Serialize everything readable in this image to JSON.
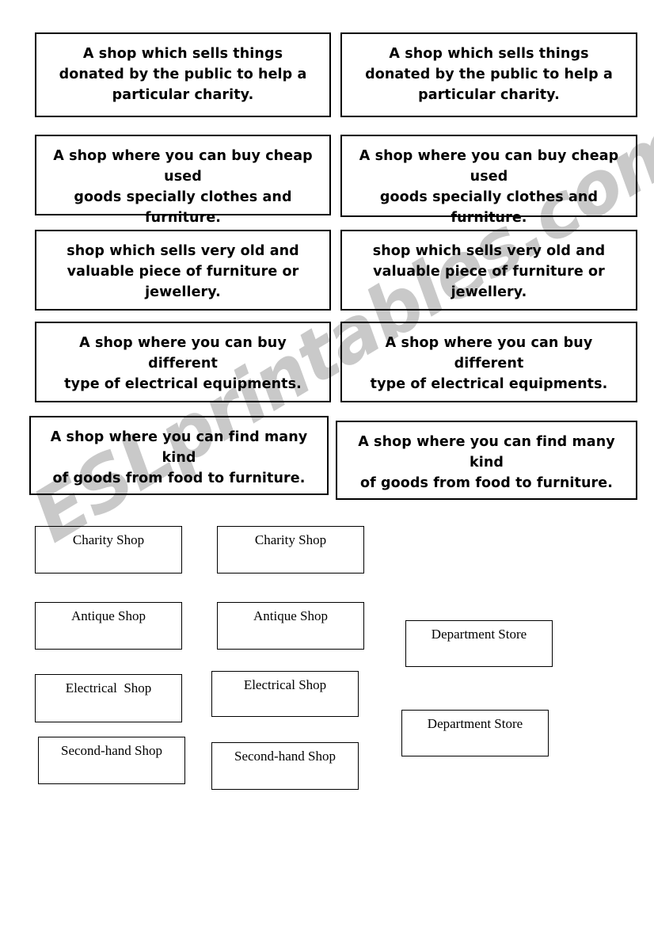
{
  "watermark": {
    "text": "ESLprintables.com",
    "color": "#c9c9c9"
  },
  "worksheet": {
    "definition_cards": [
      {
        "id": "charity-shop-definition-left",
        "text": "A shop which sells things\ndonated by the public to help a\nparticular charity.",
        "align": "center"
      },
      {
        "id": "charity-shop-definition-right",
        "text": "A shop which sells things\ndonated by the public to help a\nparticular charity.",
        "align": "center"
      },
      {
        "id": "second-hand-shop-definition-left",
        "text": "A shop where you can buy cheap used\ngoods specially clothes and furniture.",
        "align": "center"
      },
      {
        "id": "second-hand-shop-definition-right",
        "text": "A shop where you can buy cheap used\ngoods specially clothes and furniture.",
        "align": "center"
      },
      {
        "id": "antique-shop-definition-left",
        "text": "shop which sells very old and\nvaluable piece of furniture or\njewellery.",
        "align": "center"
      },
      {
        "id": "antique-shop-definition-right",
        "text": "shop which sells very old and\nvaluable piece of furniture or\njewellery.",
        "align": "center"
      },
      {
        "id": "electrical-shop-definition-left",
        "text": "A shop where you can buy different\ntype of electrical equipments.",
        "align": "center"
      },
      {
        "id": "electrical-shop-definition-right",
        "text": "A shop where you can buy different\ntype of electrical equipments.",
        "align": "center"
      },
      {
        "id": "department-store-definition-left",
        "text": "A shop where you can find many kind\nof goods from food to furniture.",
        "align": "center"
      },
      {
        "id": "department-store-definition-right",
        "text": "A shop where you can find many kind\nof goods from food to furniture.",
        "align": "center"
      }
    ],
    "label_cards": [
      {
        "id": "charity-shop-label-1",
        "text": "Charity Shop"
      },
      {
        "id": "charity-shop-label-2",
        "text": "Charity Shop"
      },
      {
        "id": "antique-shop-label-1",
        "text": "Antique Shop"
      },
      {
        "id": "antique-shop-label-2",
        "text": "Antique Shop"
      },
      {
        "id": "department-store-label-1",
        "text": "Department Store"
      },
      {
        "id": "electrical-shop-label-1",
        "text": "Electrical  Shop"
      },
      {
        "id": "electrical-shop-label-2",
        "text": "Electrical Shop"
      },
      {
        "id": "department-store-label-2",
        "text": "Department Store"
      },
      {
        "id": "second-hand-shop-label-1",
        "text": "Second-hand Shop"
      },
      {
        "id": "second-hand-shop-label-2",
        "text": "Second-hand Shop"
      }
    ]
  }
}
